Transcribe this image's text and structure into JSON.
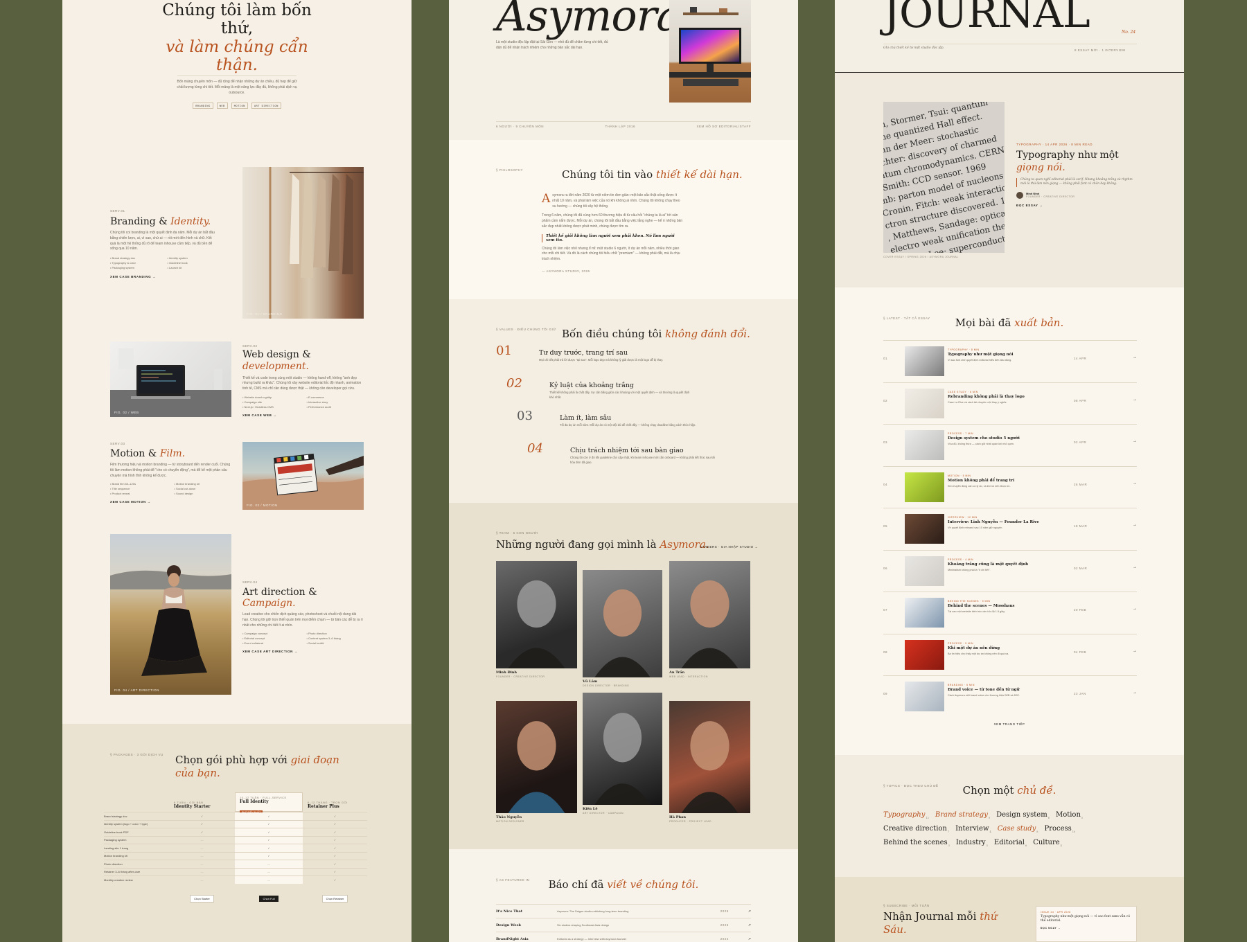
{
  "p1": {
    "hero": {
      "title_line1": "Chúng tôi làm bốn",
      "title_line2": "thứ,",
      "title_accent1": "và làm chúng cẩn",
      "title_accent2": "thận.",
      "desc": "Bốn mảng chuyên môn — đủ rộng để nhận những dự án chiều, đủ hẹp để giữ chất lượng từng chi tiết. Mỗi mảng là một năng lực đầy đủ, không phải dịch vụ outsource.",
      "tags": [
        "BRANDING",
        "WEB",
        "MOTION",
        "ART DIRECTION"
      ]
    },
    "services": [
      {
        "num": "SERV.01",
        "title": "Branding &",
        "accent": "Identity.",
        "desc": "Chúng tôi coi branding là một quyết định đa năm. Mỗi dự án bắt đầu bằng chiến lược, ai, vì sao, chứ ai — rồi mới đến hình và chữ. Kết quả là một hệ thống đủ rõ để team inhouse cầm tiếp, và đủ bền để sống qua 10 năm.",
        "items": [
          "Brand strategy doc",
          "Identity system",
          "Typography & color",
          "Guideline book",
          "Packaging system",
          "Launch kit"
        ],
        "link": "XEM CASE BRANDING →",
        "caption": "FIG. 01 / BRANDING"
      },
      {
        "num": "SERV.02",
        "title": "Web design &",
        "accent": "development.",
        "desc": "Thiết kế và code trong cùng một studio — không hand-off, không \"anh đẹp nhưng build ra khác\". Chúng tôi xây website editorial tốc độ nhanh, animation tinh tế, CMS mà chỉ cần dùng được thật — không cần developer gọi cứu.",
        "items": [
          "Website doanh nghiệp",
          "E-commerce",
          "Campaign site",
          "Interactive story",
          "Next.js / Headless CMS",
          "Performance audit"
        ],
        "link": "XEM CASE WEB →",
        "caption": "FIG. 02 / WEB"
      },
      {
        "num": "SERV.03",
        "title": "Motion &",
        "accent": "Film.",
        "desc": "Film thương hiệu và motion branding — từ storyboard đến render cuối. Chúng tôi làm motion không phải để \"cho có chuyển động\", mà để kể một phần câu chuyện mà hình tĩnh không kể được.",
        "items": [
          "Brand film 60–120s",
          "Motion branding kit",
          "Title sequence",
          "Social cut-down",
          "Product reveal",
          "Sound design"
        ],
        "link": "XEM CASE MOTION →",
        "caption": "FIG. 03 / MOTION"
      },
      {
        "num": "SERV.04",
        "title": "Art direction &",
        "accent": "Campaign.",
        "desc": "Lead creative cho chiến dịch quảng cáo, photoshoot và chuỗi nội dung dài hạn. Chúng tôi giữ trọn thiết quán trên mọi điểm chạm — từ bản các dễ bị ra rì nhất cho những chi tiết ít ai nhìn.",
        "items": [
          "Campaign concept",
          "Photo direction",
          "Editorial concept",
          "Content system 3–6 tháng",
          "Event collateral",
          "Social toolkit"
        ],
        "link": "XEM CASE ART DIRECTION →",
        "caption": "FIG. 04 / ART DIRECTION"
      }
    ],
    "packages": {
      "label": "§ PACKAGES · 3 GÓI DỊCH VỤ",
      "title": "Chọn gói phù hợp với",
      "accent": "giai đoạn của bạn.",
      "cols": [
        {
          "meta": "6 TUẦN · GÓI BẢN",
          "name": "Identity Starter",
          "badge": ""
        },
        {
          "meta": "10–12 TUẦN · FULL-SERVICE",
          "name": "Full Identity",
          "badge": "PHỔ BIẾN NHẤT"
        },
        {
          "meta": "6–12 THÁNG · TRỌN GÓI",
          "name": "Retainer Plus",
          "badge": ""
        }
      ],
      "rows": [
        {
          "label": "Brand strategy doc",
          "v": [
            "✓",
            "✓",
            "✓"
          ]
        },
        {
          "label": "Identity system (logo + color + type)",
          "v": [
            "✓",
            "✓",
            "✓"
          ]
        },
        {
          "label": "Guideline book PDF",
          "v": [
            "✓",
            "✓",
            "✓"
          ]
        },
        {
          "label": "Packaging system",
          "v": [
            "—",
            "✓",
            "✓"
          ]
        },
        {
          "label": "Landing site 1 trang",
          "v": [
            "—",
            "✓",
            "✓"
          ]
        },
        {
          "label": "Motion branding kit",
          "v": [
            "—",
            "✓",
            "✓"
          ]
        },
        {
          "label": "Photo direction",
          "v": [
            "—",
            "—",
            "✓"
          ]
        },
        {
          "label": "Retainer 3–6 tháng after-care",
          "v": [
            "—",
            "—",
            "✓"
          ]
        },
        {
          "label": "Monthly creative review",
          "v": [
            "—",
            "—",
            "✓"
          ]
        }
      ],
      "buttons": [
        "Chọn Starter",
        "Chọn Full",
        "Chọn Retainer"
      ]
    }
  },
  "p2": {
    "logo": "Asymora",
    "intro": "Là một studio độc lập đặt tại Sài Gòn — nhỏ đủ để chăm từng chi tiết, đủ dặn dủ để nhận trách nhiệm cho những bản sắc dài hạn.",
    "meta": [
      "6 NGƯỜI · 9 CHUYÊN MÔN",
      "THÀNH LẬP 2016",
      "XEM HỒ SƠ EDITORIAL/STAFF"
    ],
    "philosophy": {
      "label": "§ PHILOSOPHY",
      "title": "Chúng tôi tin vào",
      "accent": "thiết kế dài hạn.",
      "drop": "A",
      "p1": "symora ra đời năm 2020 từ một niềm tin đơn giản: một bản sắc thật sống được ít nhất 10 năm, và phải làm việc của nó khi không ai nhìn. Chúng tôi không chạy theo xu hướng — chúng tôi xây hệ thống.",
      "p2": "Trong 6 năm, chúng tôi đã cùng hơn 60 thương hiệu đi từ câu hỏi \"chúng ta là ai\" tới sản phẩm cầm nắm được. Mỗi dự án, chúng tôi bắt đầu bằng việc lắng nghe — kể ri những bản sắc đẹp nhất không được phát minh, chúng được tìm ra.",
      "quote": "Thiết kế giỏi không làm người xem phải khen. Nó làm người xem tin.",
      "p3": "Chúng tôi làm việc nhỏ nhưng tỉ mỉ: một studio 6 người, ít dự án mỗi năm, nhiều thời gian cho mỗi chi tiết. Và đó là cách chúng tôi hiểu chữ \"premium\" — không phải đắt, mà là chịu trách nhiệm.",
      "sign": "— ASYMORA STUDIO, 2026"
    },
    "values": {
      "label": "§ VALUES · ĐIỀU CHÚNG TÔI GIỮ",
      "title": "Bốn điều chúng tôi",
      "accent": "không đánh đổi.",
      "items": [
        {
          "num": "01",
          "title": "Tư duy trước, trang trí sau",
          "desc": "Mọi chi tiết phải trả lời được \"tại sao\". Mỗi logo đẹp mà không lý giải được là một logo dễ bị thay."
        },
        {
          "num": "02",
          "title": "Kỷ luật của khoảng trắng",
          "desc": "Thiết kế không phải là chất đầy. Sự cân bằng giữa các khoảng với một quyết định — và thường là quyết định khó nhất."
        },
        {
          "num": "03",
          "title": "Làm ít, làm sâu",
          "desc": "Tối đa dự án mỗi năm. Mỗi dự án có một đội đủ để chốt đầy — không chạy deadline bằng cách thức hiệp."
        },
        {
          "num": "04",
          "title": "Chịu trách nhiệm tới sau bàn giao",
          "desc": "Chúng tôi còn ở đó khi guideline cần cập nhật, khi team inhouse mới cần onboard — không phải kết thúc sau khi hóa đơn đã giao."
        }
      ]
    },
    "team": {
      "label": "§ TEAM · 6 CON NGƯỜI",
      "title": "Những người đang gọi mình là",
      "accent": "Asymora.",
      "link": "CAREERS · GIA NHẬP STUDIO →",
      "members": [
        {
          "name": "Minh Đinh",
          "role": "FOUNDER · CREATIVE DIRECTOR"
        },
        {
          "name": "Vũ Lâm",
          "role": "DESIGN DIRECTOR · BRANDING"
        },
        {
          "name": "An Trần",
          "role": "WEB LEAD · INTERACTION"
        },
        {
          "name": "Thảo Nguyễn",
          "role": "MOTION DESIGNER"
        },
        {
          "name": "Kiên Lê",
          "role": "ART DIRECTOR · CAMPAIGN"
        },
        {
          "name": "Hà Phan",
          "role": "PRODUCER · PROJECT LEAD"
        }
      ]
    },
    "press": {
      "label": "§ AS FEATURED IN",
      "title": "Báo chí đã",
      "accent": "viết về chúng tôi.",
      "rows": [
        {
          "pub": "It's Nice That",
          "desc": "Asymora: The Saigon studio rethinking long-term branding",
          "year": "2025"
        },
        {
          "pub": "Design Week",
          "desc": "Six studios shaping Southeast Asia design",
          "year": "2025"
        },
        {
          "pub": "BrandNight Asia",
          "desc": "Editorial as a strategy — Interview with Asymora founder",
          "year": "2024"
        }
      ]
    }
  },
  "p3": {
    "masthead": "JOURNAL",
    "issue": "No. 24",
    "tagline": "Ghi chú thiết kế từ một studio độc lập.",
    "count": "8 ESSAY MỚI · 1 INTERVIEW",
    "featured": {
      "meta": "TYPOGRAPHY · 14 APR 2026 · 8 MIN READ",
      "title": "Typography như một",
      "accent": "giọng nói.",
      "quote": "Chúng ta quen nghĩ editorial phải là serif. Nhưng khoảng trắng và rhythm mới là thứ làm nên giọng — không phải font có chân hay không.",
      "author": "Minh Đinh",
      "author_role": "FOUNDER · CREATIVE DIRECTOR",
      "link": "ĐỌC ESSAY →",
      "caption": "COVER ESSAY / SPRING 2026 / ASYMORA JOURNAL"
    },
    "latest": {
      "label": "§ LATEST · TẤT CẢ ESSAY",
      "title": "Mọi bài đã",
      "accent": "xuất bản.",
      "items": [
        {
          "n": "01",
          "cat": "TYPOGRAPHY · 8 MIN",
          "title": "Typography như một giọng nói",
          "desc": "Vì sao font chữ quyết định editorial hiểu đến đâu đúng.",
          "date": "14 APR"
        },
        {
          "n": "02",
          "cat": "CASE STUDY · 6 MIN",
          "title": "Rebranding không phải là thay logo",
          "desc": "Case La Rive và cách tái chuyên một thay ý nghĩa.",
          "date": "08 APR"
        },
        {
          "n": "03",
          "cat": "PROCESS · 7 MIN",
          "title": "Design system cho studio 5 người",
          "desc": "Vừa đủ, không thừa — cách giữ nhất quán khi nhỏ quen.",
          "date": "02 APR"
        },
        {
          "n": "04",
          "cat": "MOTION · 5 MIN",
          "title": "Motion không phải để trang trí",
          "desc": "Khi chuyển động cần có lý do, và khi nó nên được im.",
          "date": "26 MAR"
        },
        {
          "n": "05",
          "cat": "INTERVIEW · 12 MIN",
          "title": "Interview: Linh Nguyễn — Founder La Rive",
          "desc": "Về quyết định rebrand sau 10 năm giữ nguyên.",
          "date": "18 MAR"
        },
        {
          "n": "06",
          "cat": "PROCESS · 4 MIN",
          "title": "Khoảng trắng cũng là một quyết định",
          "desc": "Minimalism không phải là \"ít chi tiết\".",
          "date": "02 MAR"
        },
        {
          "n": "07",
          "cat": "BEHIND THE SCENES · 9 MIN",
          "title": "Behind the scenes — Mosshaus",
          "desc": "Tại sao một website kiến trúc cần tốc độ 1.5 giây.",
          "date": "20 FEB"
        },
        {
          "n": "08",
          "cat": "PROCESS · 5 MIN",
          "title": "Khi một dự án nên dừng",
          "desc": "Ba tín hiệu cho thấy một dự án không nên đi quá xa.",
          "date": "04 FEB"
        },
        {
          "n": "09",
          "cat": "BRANDING · 6 MIN",
          "title": "Brand voice — từ tone đến từ ngữ",
          "desc": "Cách Asymora viết brand voice cho thương hiệu B2B và D2C.",
          "date": "23 JAN"
        }
      ],
      "more": "XEM TRANG TIẾP"
    },
    "topics": {
      "label": "§ TOPICS · ĐỌC THEO CHỦ ĐỀ",
      "title": "Chọn một",
      "accent": "chủ đề.",
      "items": [
        {
          "name": "Typography",
          "count": "12",
          "hl": true
        },
        {
          "name": "Brand strategy",
          "count": "9",
          "hl": true
        },
        {
          "name": "Design system",
          "count": "6",
          "hl": false
        },
        {
          "name": "Motion",
          "count": "5",
          "hl": false
        },
        {
          "name": "Creative direction",
          "count": "7",
          "hl": false
        },
        {
          "name": "Interview",
          "count": "4",
          "hl": false
        },
        {
          "name": "Case study",
          "count": "8",
          "hl": true
        },
        {
          "name": "Process",
          "count": "10",
          "hl": false
        },
        {
          "name": "Behind the scenes",
          "count": "3",
          "hl": false
        },
        {
          "name": "Industry",
          "count": "5",
          "hl": false
        },
        {
          "name": "Editorial",
          "count": "6",
          "hl": false
        },
        {
          "name": "Culture",
          "count": "4",
          "hl": false
        }
      ]
    },
    "newsletter": {
      "label": "§ SUBSCRIBE · MỖI TUẦN",
      "title": "Nhận Journal mỗi",
      "accent": "thứ Sáu.",
      "card_meta": "ISSUE 24 · APR 2026",
      "card_text": "Typography như một giọng nói — vì sao font sans vẫn có thể editorial.",
      "card_link": "ĐỌC NGAY →"
    }
  },
  "colors": {
    "accent": "#b8521e",
    "bg": "#58603f",
    "paper": "#f6f0e6"
  }
}
